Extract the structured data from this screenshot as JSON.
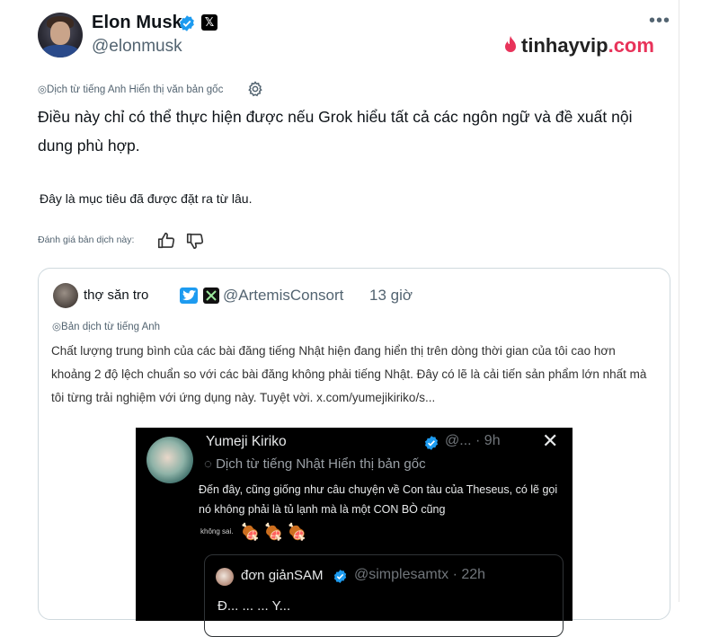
{
  "header": {
    "name": "Elon Musk",
    "handle": "@elonmusk",
    "x_badge": "𝕏",
    "more": "•••",
    "watermark": {
      "brand": "tinhayvip",
      "suffix": ".com"
    }
  },
  "translation": {
    "notice": "◎Dịch từ tiếng Anh Hiển thị văn bản gốc",
    "main_text": "Điều này chỉ có thể thực hiện được nếu Grok hiểu tất cả các ngôn ngữ và đề xuất nội dung phù hợp.",
    "sub_text": "Đây là mục tiêu đã được đặt ra từ lâu.",
    "rate_label": "Đánh giá bản dịch này:"
  },
  "quote": {
    "name": "thợ săn tro",
    "handle": "@ArtemisConsort",
    "time": "13 giờ",
    "translate_notice": "◎Bản dịch từ tiếng Anh",
    "text": "Chất lượng trung bình của các bài đăng tiếng Nhật hiện đang hiển thị trên dòng thời gian của tôi cao hơn khoảng 2 độ lệch chuẩn so với các bài đăng không phải tiếng Nhật. Đây có lẽ là cải tiến sản phẩm lớn nhất mà tôi từng trải nghiệm với ứng dụng này. Tuyệt vời. x.com/yumejikiriko/s...",
    "embed": {
      "name": "Yumeji Kiriko",
      "handle": "@... · 9h",
      "x_mark": "✕",
      "translate": "◌ Dịch từ tiếng Nhật Hiển thị bản gốc",
      "text": "Đến đây, cũng giống như câu chuyện về Con tàu của Theseus, có lẽ gọi nó không phải là tủ lạnh mà là một CON BÒ cũng",
      "small": "không sai.",
      "emoji": [
        "🍖",
        "🍖",
        "🍖"
      ],
      "inner": {
        "name": "đơn giảnSAM",
        "handle": "@simplesamtx · 22h",
        "cut_text": "Đ... ... ... Y..."
      }
    }
  },
  "colors": {
    "verified": "#1d9bf0",
    "muted": "#536471",
    "accent": "#e8335a"
  }
}
